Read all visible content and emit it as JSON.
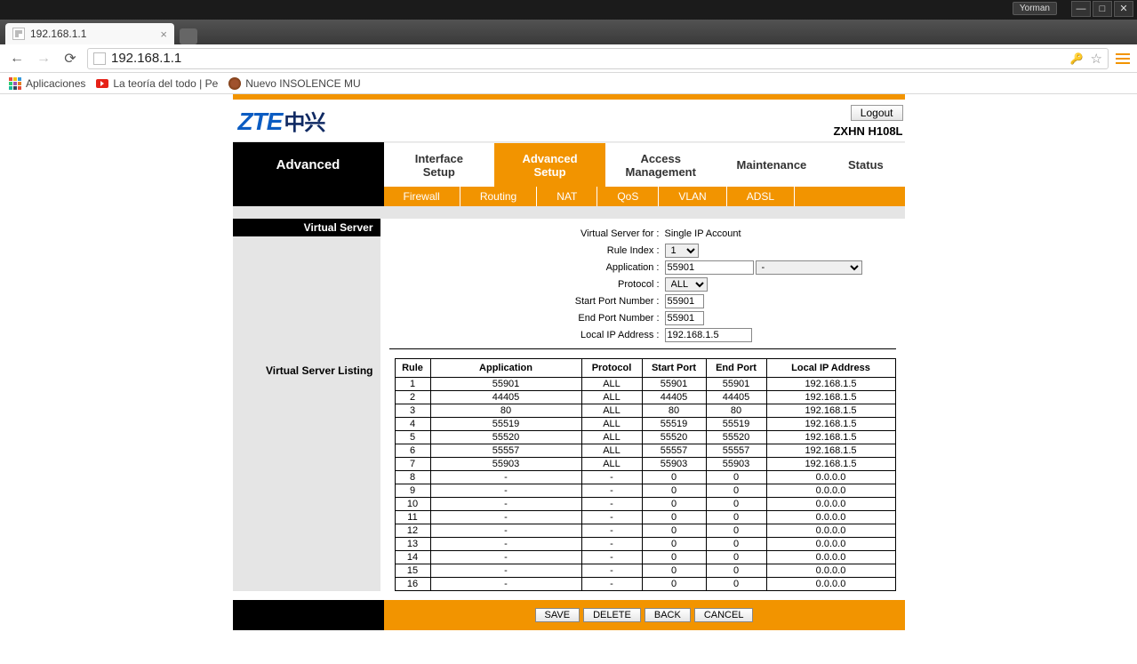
{
  "browser": {
    "user_badge": "Yorman",
    "tab_title": "192.168.1.1",
    "address": "192.168.1.1",
    "bookmarks": {
      "apps": "Aplicaciones",
      "yt": "La teoría del todo | Pe",
      "bug": "Nuevo INSOLENCE MU"
    }
  },
  "router": {
    "logout": "Logout",
    "model": "ZXHN H108L",
    "logo_main": "ZTE",
    "logo_cjk": "中兴",
    "nav": {
      "current": "Advanced",
      "items": [
        "Interface\nSetup",
        "Advanced\nSetup",
        "Access\nManagement",
        "Maintenance",
        "Status"
      ]
    },
    "subnav": [
      "Firewall",
      "Routing",
      "NAT",
      "QoS",
      "VLAN",
      "ADSL"
    ],
    "section_title": "Virtual Server",
    "listing_title": "Virtual Server Listing",
    "form": {
      "vs_for_label": "Virtual Server for :",
      "vs_for_value": "Single IP Account",
      "rule_index_label": "Rule Index :",
      "rule_index_value": "1",
      "application_label": "Application :",
      "application_value": "55901",
      "application_preset": "-",
      "protocol_label": "Protocol :",
      "protocol_value": "ALL",
      "start_port_label": "Start Port Number :",
      "start_port_value": "55901",
      "end_port_label": "End Port Number :",
      "end_port_value": "55901",
      "local_ip_label": "Local IP Address :",
      "local_ip_value": "192.168.1.5"
    },
    "table": {
      "headers": [
        "Rule",
        "Application",
        "Protocol",
        "Start Port",
        "End Port",
        "Local IP Address"
      ],
      "rows": [
        {
          "rule": "1",
          "app": "55901",
          "proto": "ALL",
          "start": "55901",
          "end": "55901",
          "ip": "192.168.1.5"
        },
        {
          "rule": "2",
          "app": "44405",
          "proto": "ALL",
          "start": "44405",
          "end": "44405",
          "ip": "192.168.1.5"
        },
        {
          "rule": "3",
          "app": "80",
          "proto": "ALL",
          "start": "80",
          "end": "80",
          "ip": "192.168.1.5"
        },
        {
          "rule": "4",
          "app": "55519",
          "proto": "ALL",
          "start": "55519",
          "end": "55519",
          "ip": "192.168.1.5"
        },
        {
          "rule": "5",
          "app": "55520",
          "proto": "ALL",
          "start": "55520",
          "end": "55520",
          "ip": "192.168.1.5"
        },
        {
          "rule": "6",
          "app": "55557",
          "proto": "ALL",
          "start": "55557",
          "end": "55557",
          "ip": "192.168.1.5"
        },
        {
          "rule": "7",
          "app": "55903",
          "proto": "ALL",
          "start": "55903",
          "end": "55903",
          "ip": "192.168.1.5"
        },
        {
          "rule": "8",
          "app": "-",
          "proto": "-",
          "start": "0",
          "end": "0",
          "ip": "0.0.0.0"
        },
        {
          "rule": "9",
          "app": "-",
          "proto": "-",
          "start": "0",
          "end": "0",
          "ip": "0.0.0.0"
        },
        {
          "rule": "10",
          "app": "-",
          "proto": "-",
          "start": "0",
          "end": "0",
          "ip": "0.0.0.0"
        },
        {
          "rule": "11",
          "app": "-",
          "proto": "-",
          "start": "0",
          "end": "0",
          "ip": "0.0.0.0"
        },
        {
          "rule": "12",
          "app": "-",
          "proto": "-",
          "start": "0",
          "end": "0",
          "ip": "0.0.0.0"
        },
        {
          "rule": "13",
          "app": "-",
          "proto": "-",
          "start": "0",
          "end": "0",
          "ip": "0.0.0.0"
        },
        {
          "rule": "14",
          "app": "-",
          "proto": "-",
          "start": "0",
          "end": "0",
          "ip": "0.0.0.0"
        },
        {
          "rule": "15",
          "app": "-",
          "proto": "-",
          "start": "0",
          "end": "0",
          "ip": "0.0.0.0"
        },
        {
          "rule": "16",
          "app": "-",
          "proto": "-",
          "start": "0",
          "end": "0",
          "ip": "0.0.0.0"
        }
      ]
    },
    "actions": {
      "save": "SAVE",
      "delete": "DELETE",
      "back": "BACK",
      "cancel": "CANCEL"
    }
  }
}
